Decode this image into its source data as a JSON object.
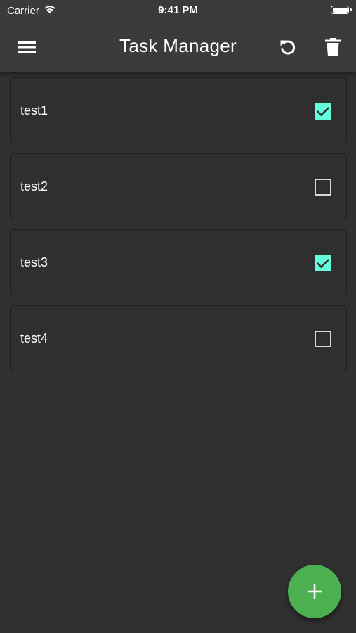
{
  "status_bar": {
    "carrier": "Carrier",
    "time": "9:41 PM",
    "wifi_icon": "wifi-icon",
    "battery_icon": "battery-icon"
  },
  "app_bar": {
    "title": "Task Manager",
    "menu_icon": "menu-icon",
    "refresh_icon": "refresh-icon",
    "delete_icon": "delete-icon"
  },
  "tasks": [
    {
      "label": "test1",
      "checked": true
    },
    {
      "label": "test2",
      "checked": false
    },
    {
      "label": "test3",
      "checked": true
    },
    {
      "label": "test4",
      "checked": false
    }
  ],
  "fab": {
    "icon": "plus-icon"
  },
  "colors": {
    "background": "#303030",
    "app_bar": "#3b3b3b",
    "checkbox_checked": "#64ffda",
    "fab": "#4caf50"
  }
}
